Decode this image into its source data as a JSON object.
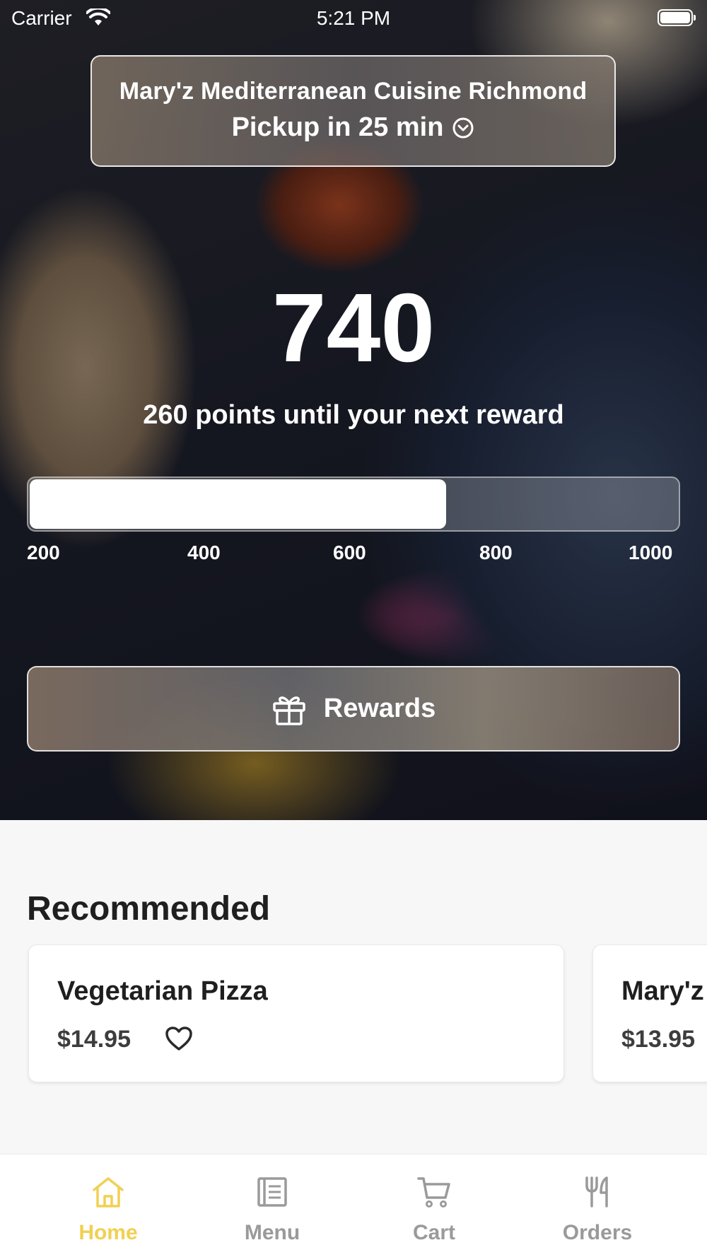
{
  "status_bar": {
    "carrier": "Carrier",
    "time": "5:21 PM"
  },
  "location": {
    "name": "Mary'z Mediterranean Cuisine Richmond",
    "pickup": "Pickup in 25 min"
  },
  "points": {
    "value": "740",
    "caption": "260 points until your next reward",
    "progress_fraction": 0.64,
    "scale": [
      "200",
      "400",
      "600",
      "800",
      "1000"
    ]
  },
  "rewards_button": {
    "label": "Rewards"
  },
  "recommended": {
    "title": "Recommended",
    "items": [
      {
        "name": "Vegetarian Pizza",
        "price": "$14.95"
      },
      {
        "name": "Mary'z",
        "price": "$13.95"
      }
    ]
  },
  "tabs": [
    {
      "label": "Home",
      "icon": "home-icon",
      "active": true
    },
    {
      "label": "Menu",
      "icon": "menu-icon",
      "active": false
    },
    {
      "label": "Cart",
      "icon": "cart-icon",
      "active": false
    },
    {
      "label": "Orders",
      "icon": "fork-knife-icon",
      "active": false
    }
  ],
  "colors": {
    "accent": "#f1d052",
    "inactive_tab": "#9a9a9a"
  }
}
